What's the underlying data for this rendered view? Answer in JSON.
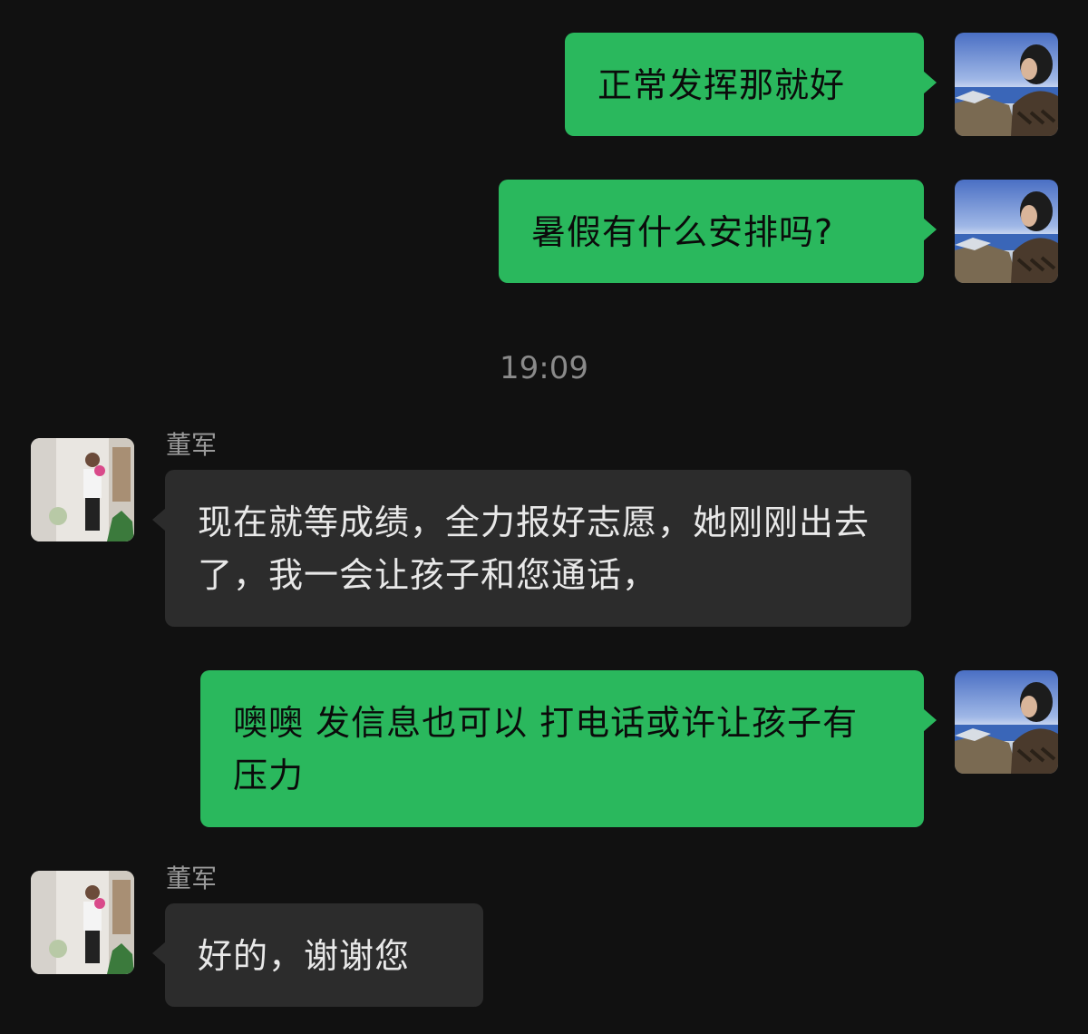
{
  "colors": {
    "background": "#111111",
    "outgoing_bubble": "#2ab85d",
    "incoming_bubble": "#2c2c2c",
    "sender_name": "#9a9a9a",
    "timestamp": "#8a8a8a"
  },
  "timestamp": "19:09",
  "messages": [
    {
      "direction": "outgoing",
      "avatar": "self-avatar-icon",
      "text": "正常发挥那就好"
    },
    {
      "direction": "outgoing",
      "avatar": "self-avatar-icon",
      "text": "暑假有什么安排吗?"
    },
    {
      "direction": "incoming",
      "avatar": "contact-avatar-icon",
      "sender": "董军",
      "text": "现在就等成绩，全力报好志愿，她刚刚出去了，我一会让孩子和您通话，"
    },
    {
      "direction": "outgoing",
      "avatar": "self-avatar-icon",
      "text": "噢噢 发信息也可以 打电话或许让孩子有压力"
    },
    {
      "direction": "incoming",
      "avatar": "contact-avatar-icon",
      "sender": "董军",
      "text": "好的，谢谢您"
    }
  ]
}
